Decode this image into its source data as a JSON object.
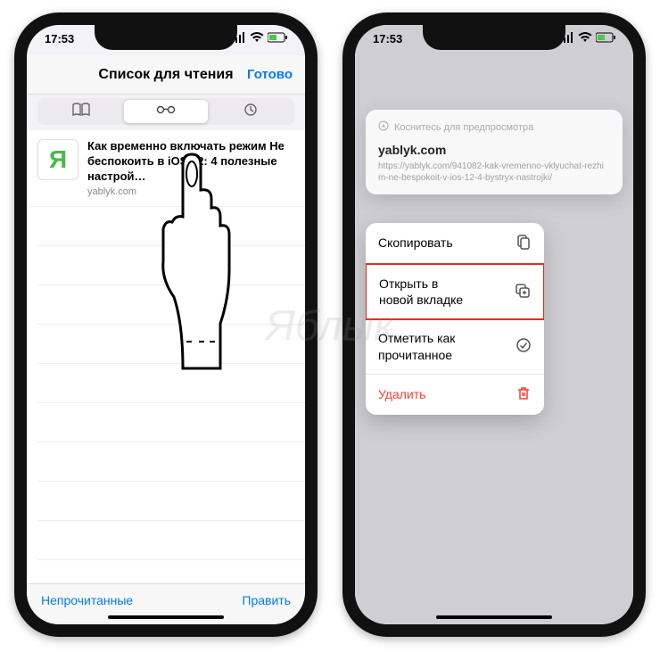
{
  "status": {
    "time": "17:53"
  },
  "left": {
    "nav_title": "Список для чтения",
    "nav_done": "Готово",
    "item": {
      "logo_letter": "Я",
      "title": "Как временно включать режим Не беспокоить в iOS 12: 4 полезные настрой…",
      "domain": "yablyk.com"
    },
    "bottom": {
      "unread": "Непрочитанные",
      "edit": "Править"
    }
  },
  "right": {
    "preview": {
      "hint": "Коснитесь для предпросмотра",
      "domain": "yablyk.com",
      "url": "https://yablyk.com/941082-kak-vremenno-vklyuchat-rezhim-ne-bespokoit-v-ios-12-4-bystryx-nastrojki/"
    },
    "menu": {
      "copy": "Скопировать",
      "open_new_tab": "Открыть в\nновой вкладке",
      "mark_read": "Отметить как\nпрочитанное",
      "delete": "Удалить"
    }
  },
  "watermark": "Яблык"
}
